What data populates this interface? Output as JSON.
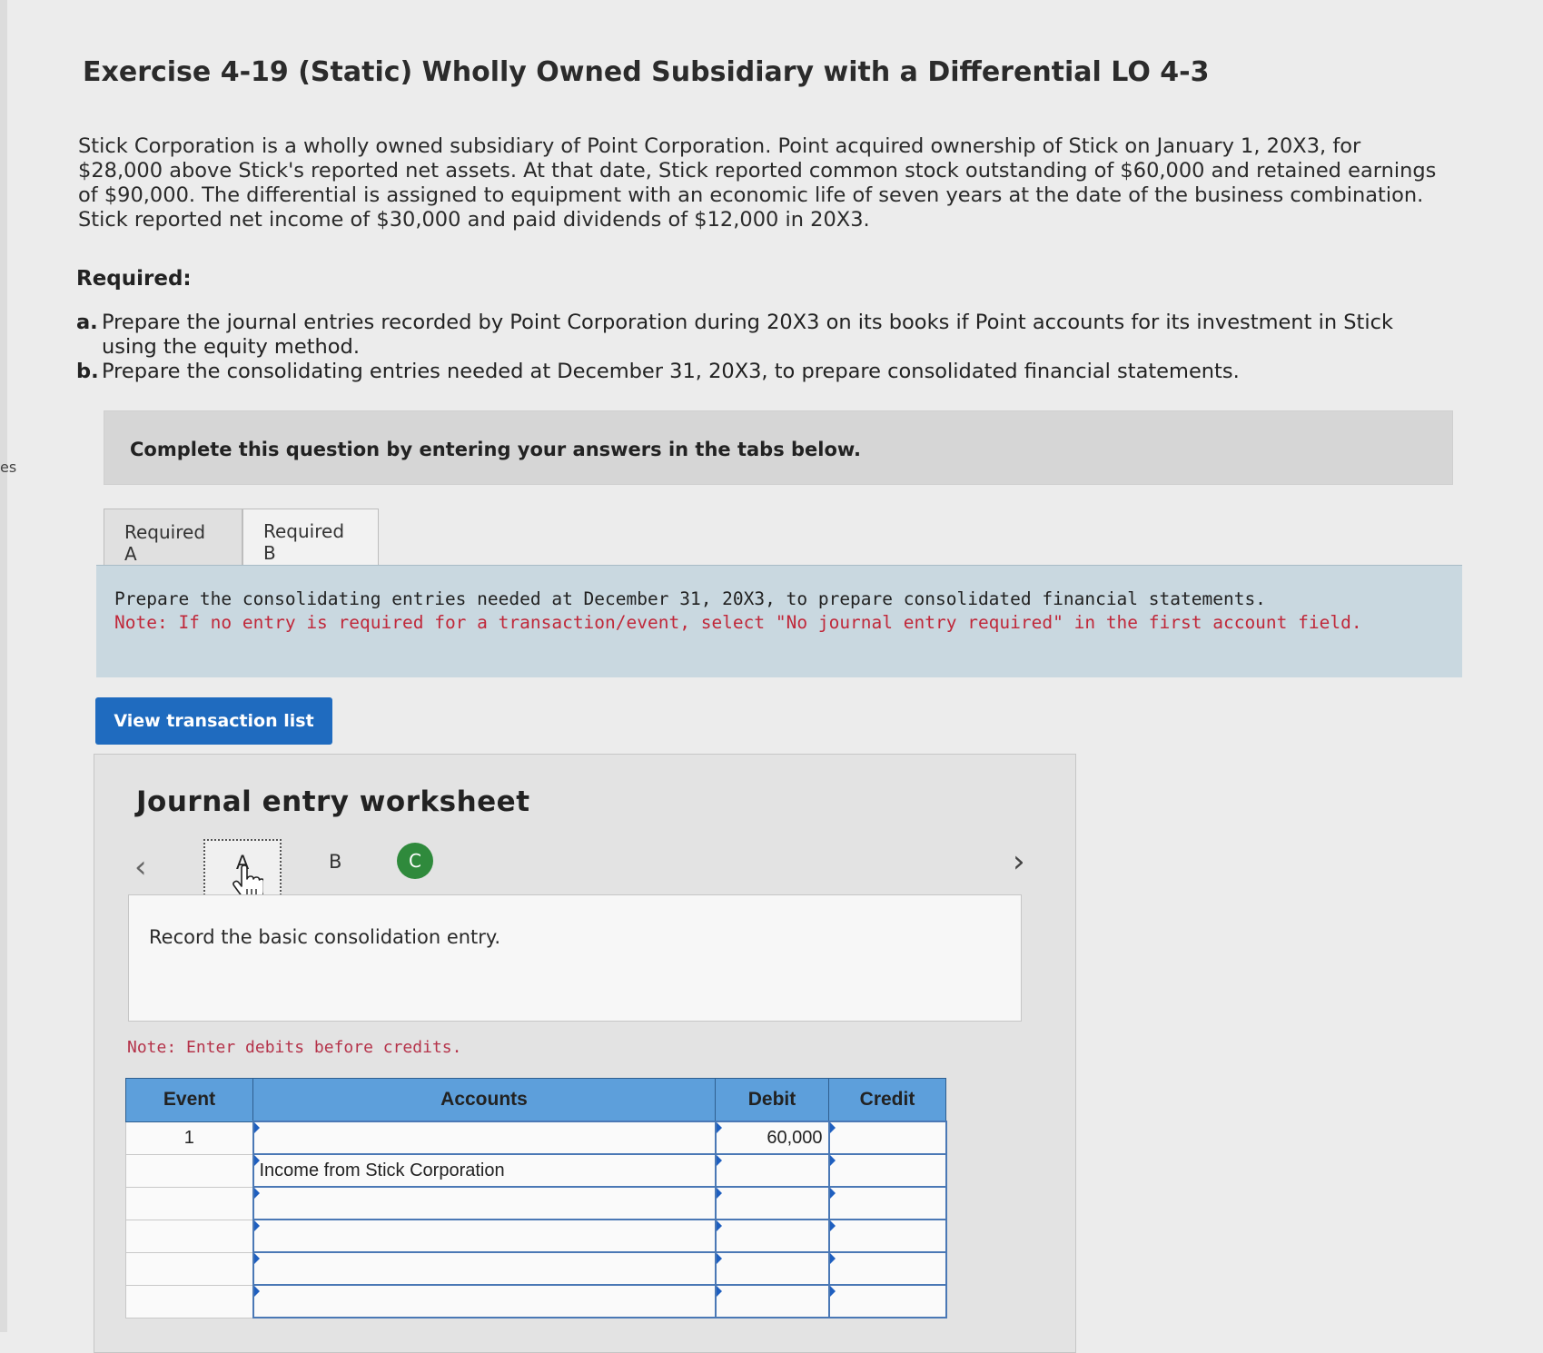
{
  "side_fragment": "es",
  "header": {
    "title": "Exercise 4-19 (Static) Wholly Owned Subsidiary with a Differential LO 4-3"
  },
  "problem_text": "Stick Corporation is a wholly owned subsidiary of Point Corporation. Point acquired ownership of Stick on January 1, 20X3, for $28,000 above Stick's reported net assets. At that date, Stick reported common stock outstanding of $60,000 and retained earnings of $90,000. The differential is assigned to equipment with an economic life of seven years at the date of the business combination. Stick reported net income of $30,000 and paid dividends of $12,000 in 20X3.",
  "required": {
    "title": "Required:",
    "items": [
      {
        "label": "a.",
        "text": "Prepare the journal entries recorded by Point Corporation during 20X3 on its books if Point accounts for its investment in Stick using the equity method."
      },
      {
        "label": "b.",
        "text": "Prepare the consolidating entries needed at December 31, 20X3, to prepare consolidated financial statements."
      }
    ]
  },
  "instructions": "Complete this question by entering your answers in the tabs below.",
  "tabs": [
    {
      "label": "Required A"
    },
    {
      "label": "Required B"
    }
  ],
  "panel": {
    "text": "Prepare the consolidating entries needed at December 31, 20X3, to prepare consolidated financial statements.",
    "note": "Note: If no entry is required for a transaction/event, select \"No journal entry required\" in the first account field."
  },
  "view_button": "View transaction list",
  "worksheet": {
    "title": "Journal entry worksheet",
    "events": [
      "A",
      "B",
      "C"
    ],
    "entry_instruction": "Record the basic consolidation entry.",
    "debit_note": "Note: Enter debits before credits.",
    "columns": [
      "Event",
      "Accounts",
      "Debit",
      "Credit"
    ],
    "rows": [
      {
        "event": "1",
        "account": "",
        "debit": "60,000",
        "credit": ""
      },
      {
        "event": "",
        "account": "Income from Stick Corporation",
        "debit": "",
        "credit": ""
      },
      {
        "event": "",
        "account": "",
        "debit": "",
        "credit": ""
      },
      {
        "event": "",
        "account": "",
        "debit": "",
        "credit": ""
      },
      {
        "event": "",
        "account": "",
        "debit": "",
        "credit": ""
      },
      {
        "event": "",
        "account": "",
        "debit": "",
        "credit": ""
      }
    ]
  },
  "colors": {
    "accent_button": "#1f6bbf",
    "table_header": "#5d9fdb",
    "note_red": "#c0283a",
    "event_c_green": "#2f8a3c"
  }
}
